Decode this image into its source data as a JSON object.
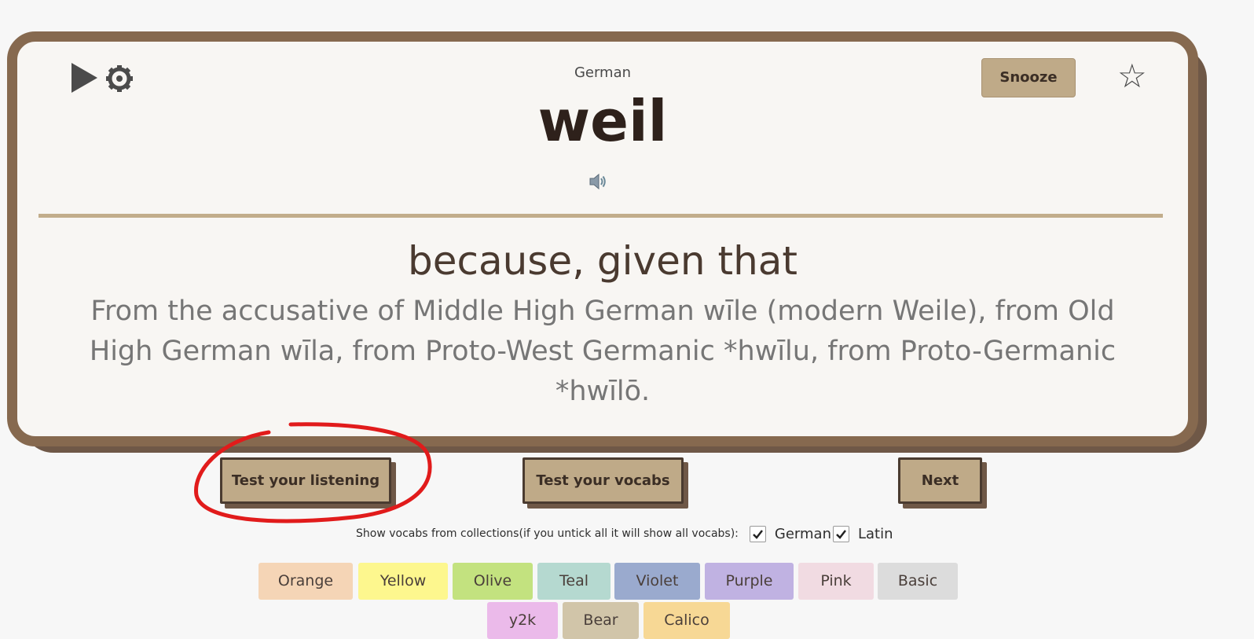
{
  "card": {
    "language": "German",
    "word": "weil",
    "meaning": "because, given that",
    "etymology": "From the accusative of Middle High German wīle (modern Weile), from Old High German wīla, from Proto-West Germanic *hwīlu, from Proto-Germanic *hwīlō.",
    "snooze_label": "Snooze",
    "icons": {
      "play": "play-icon",
      "settings": "gear-icon",
      "sound": "speaker-icon",
      "favorite": "star-icon"
    }
  },
  "actions": {
    "listen_label": "Test your listening",
    "vocab_label": "Test your vocabs",
    "next_label": "Next"
  },
  "collections": {
    "label": "Show vocabs from collections(if you untick all it will show all vocabs):",
    "items": [
      {
        "name": "German",
        "checked": true
      },
      {
        "name": "Latin",
        "checked": true
      }
    ]
  },
  "color_filters": [
    {
      "label": "Orange",
      "color": "#f5d5b6"
    },
    {
      "label": "Yellow",
      "color": "#fdf78e"
    },
    {
      "label": "Olive",
      "color": "#c3e27f"
    },
    {
      "label": "Teal",
      "color": "#b5d9d0"
    },
    {
      "label": "Violet",
      "color": "#9aaace"
    },
    {
      "label": "Purple",
      "color": "#c0b2e2"
    },
    {
      "label": "Pink",
      "color": "#f1dbe2"
    },
    {
      "label": "Basic",
      "color": "#dcdcdc"
    },
    {
      "label": "y2k",
      "color": "#ebbaea"
    },
    {
      "label": "Bear",
      "color": "#d1c5a9"
    },
    {
      "label": "Calico",
      "color": "#f7d895"
    }
  ],
  "annotation": {
    "color": "#e11b1b"
  }
}
